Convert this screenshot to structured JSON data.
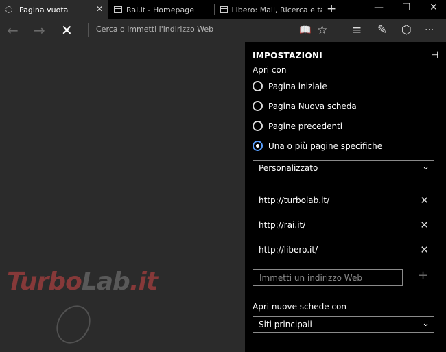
{
  "tabs": [
    {
      "title": "Pagina vuota",
      "active": true
    },
    {
      "title": "Rai.it - Homepage",
      "active": false
    },
    {
      "title": "Libero: Mail, Ricerca e tanto",
      "active": false
    }
  ],
  "tab_close_glyph": "✕",
  "newtab_glyph": "+",
  "window_controls": {
    "minimize": "—",
    "maximize": "☐",
    "close": "✕"
  },
  "address_bar": {
    "back": "←",
    "forward": "→",
    "stop": "✕",
    "placeholder": "Cerca o immetti l'indirizzo Web",
    "reading_view": "📖",
    "favorite": "☆",
    "hub": "≡",
    "notes": "✎",
    "share": "⬡",
    "more": "···"
  },
  "settings": {
    "title": "IMPOSTAZIONI",
    "pin_glyph": "⊣",
    "open_with_label": "Apri con",
    "options": [
      {
        "label": "Pagina iniziale",
        "checked": false
      },
      {
        "label": "Pagina Nuova scheda",
        "checked": false
      },
      {
        "label": "Pagine precedenti",
        "checked": false
      },
      {
        "label": "Una o più pagine specifiche",
        "checked": true
      }
    ],
    "custom_select": "Personalizzato",
    "urls": [
      "http://turbolab.it/",
      "http://rai.it/",
      "http://libero.it/"
    ],
    "delete_glyph": "✕",
    "add_url_placeholder": "Immetti un indirizzo Web",
    "add_glyph": "+",
    "new_tabs_label": "Apri nuove schede con",
    "new_tabs_select": "Siti principali",
    "chevron": "⌄"
  },
  "watermark": {
    "part1": "Turbo",
    "part2": "Lab",
    "part3": ".it"
  },
  "accent_color": "#5aa0ff"
}
